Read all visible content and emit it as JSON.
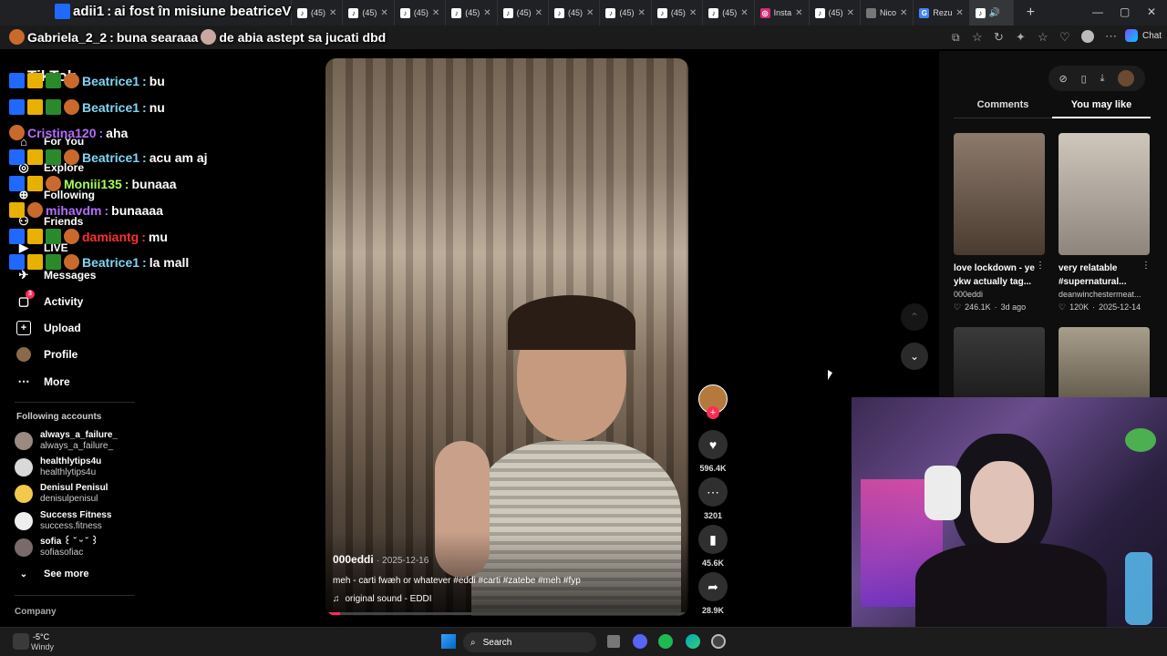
{
  "tabs": [
    {
      "label": "(45)"
    },
    {
      "label": "(45)"
    },
    {
      "label": "(45)"
    },
    {
      "label": "(45)"
    },
    {
      "label": "(45)"
    },
    {
      "label": "(45)"
    },
    {
      "label": "(45)"
    },
    {
      "label": "(45)"
    },
    {
      "label": "(45)"
    },
    {
      "label": "Insta"
    },
    {
      "label": "(45)"
    },
    {
      "label": "Nico"
    },
    {
      "label": "Rezu"
    }
  ],
  "browser": {
    "chat_label": "Chat",
    "add_tab": "+",
    "minimize": "—",
    "maximize": "▢",
    "close": "✕"
  },
  "sidebar": {
    "brand": "TikTok",
    "items": [
      {
        "label": "For You"
      },
      {
        "label": "Explore"
      },
      {
        "label": "Following"
      },
      {
        "label": "Friends"
      },
      {
        "label": "LIVE"
      },
      {
        "label": "Messages"
      },
      {
        "label": "Activity",
        "badge": "3"
      },
      {
        "label": "Upload"
      },
      {
        "label": "Profile"
      },
      {
        "label": "More"
      }
    ],
    "following_title": "Following accounts",
    "accounts": [
      {
        "name": "always_a_failure_",
        "handle": "always_a_failure_"
      },
      {
        "name": "healthlytips4u",
        "handle": "healthlytips4u"
      },
      {
        "name": "Denisul Penisul",
        "handle": "denisulpenisul"
      },
      {
        "name": "Success Fitness",
        "handle": "success.fitness"
      },
      {
        "name": "sofia ꒰ ˘ ᵕ ˘ ꒱",
        "handle": "sofiasofiac"
      }
    ],
    "see_more": "See more",
    "company": "Company"
  },
  "chat": [
    {
      "user": "adii1",
      "text": "ai fost în misiune beatriceV",
      "color": "#ffffff"
    },
    {
      "user": "Gabriela_2_2",
      "text": "buna searaaa",
      "color": "#ffffff"
    },
    {
      "user": "Beatrice1",
      "text": "bu",
      "color": "#7fd6f5"
    },
    {
      "user": "Beatrice1",
      "text": "nu",
      "color": "#7fd6f5"
    },
    {
      "user": "Cristina120",
      "text": "aha",
      "color": "#b46cff"
    },
    {
      "user": "Beatrice1",
      "text": "acu am aj",
      "color": "#7fd6f5"
    },
    {
      "user": "Moniii135",
      "text": "bunaaa",
      "color": "#a8ff5a"
    },
    {
      "user": "mihavdm",
      "text": "bunaaaa",
      "color": "#b46cff"
    },
    {
      "user": "damiantg",
      "text": "mu",
      "color": "#ff3030"
    },
    {
      "user": "Beatrice1",
      "text": "la mall",
      "color": "#7fd6f5"
    }
  ],
  "chat_extra": {
    "gabriela_tail": "de abia astept sa jucati dbd"
  },
  "video": {
    "author": "000eddi",
    "date": "2025-12-16",
    "caption": "meh - carti fwæh or whatever #eddi #carti #zatebe #meh #fyp",
    "sound": "original sound - EDDI"
  },
  "actions": {
    "likes": "596.4K",
    "comments": "3201",
    "saves": "45.6K",
    "shares": "28.9K"
  },
  "right_panel": {
    "tabs": [
      "Comments",
      "You may like"
    ],
    "active_tab": "You may like",
    "cards": [
      {
        "caption": "love lockdown - ye ykw actually tag...",
        "author": "000eddi",
        "likes": "246.1K",
        "date": "3d ago"
      },
      {
        "caption": "very relatable #supernatural...",
        "author": "deanwinchestermeat...",
        "likes": "120K",
        "date": "2025-12-14"
      }
    ]
  },
  "taskbar": {
    "weather_temp": "-5°C",
    "weather_desc": "Windy",
    "search": "Search"
  },
  "colors": {
    "accent_red": "#fe2c55",
    "bg": "#000000",
    "tabbar": "#202124"
  }
}
